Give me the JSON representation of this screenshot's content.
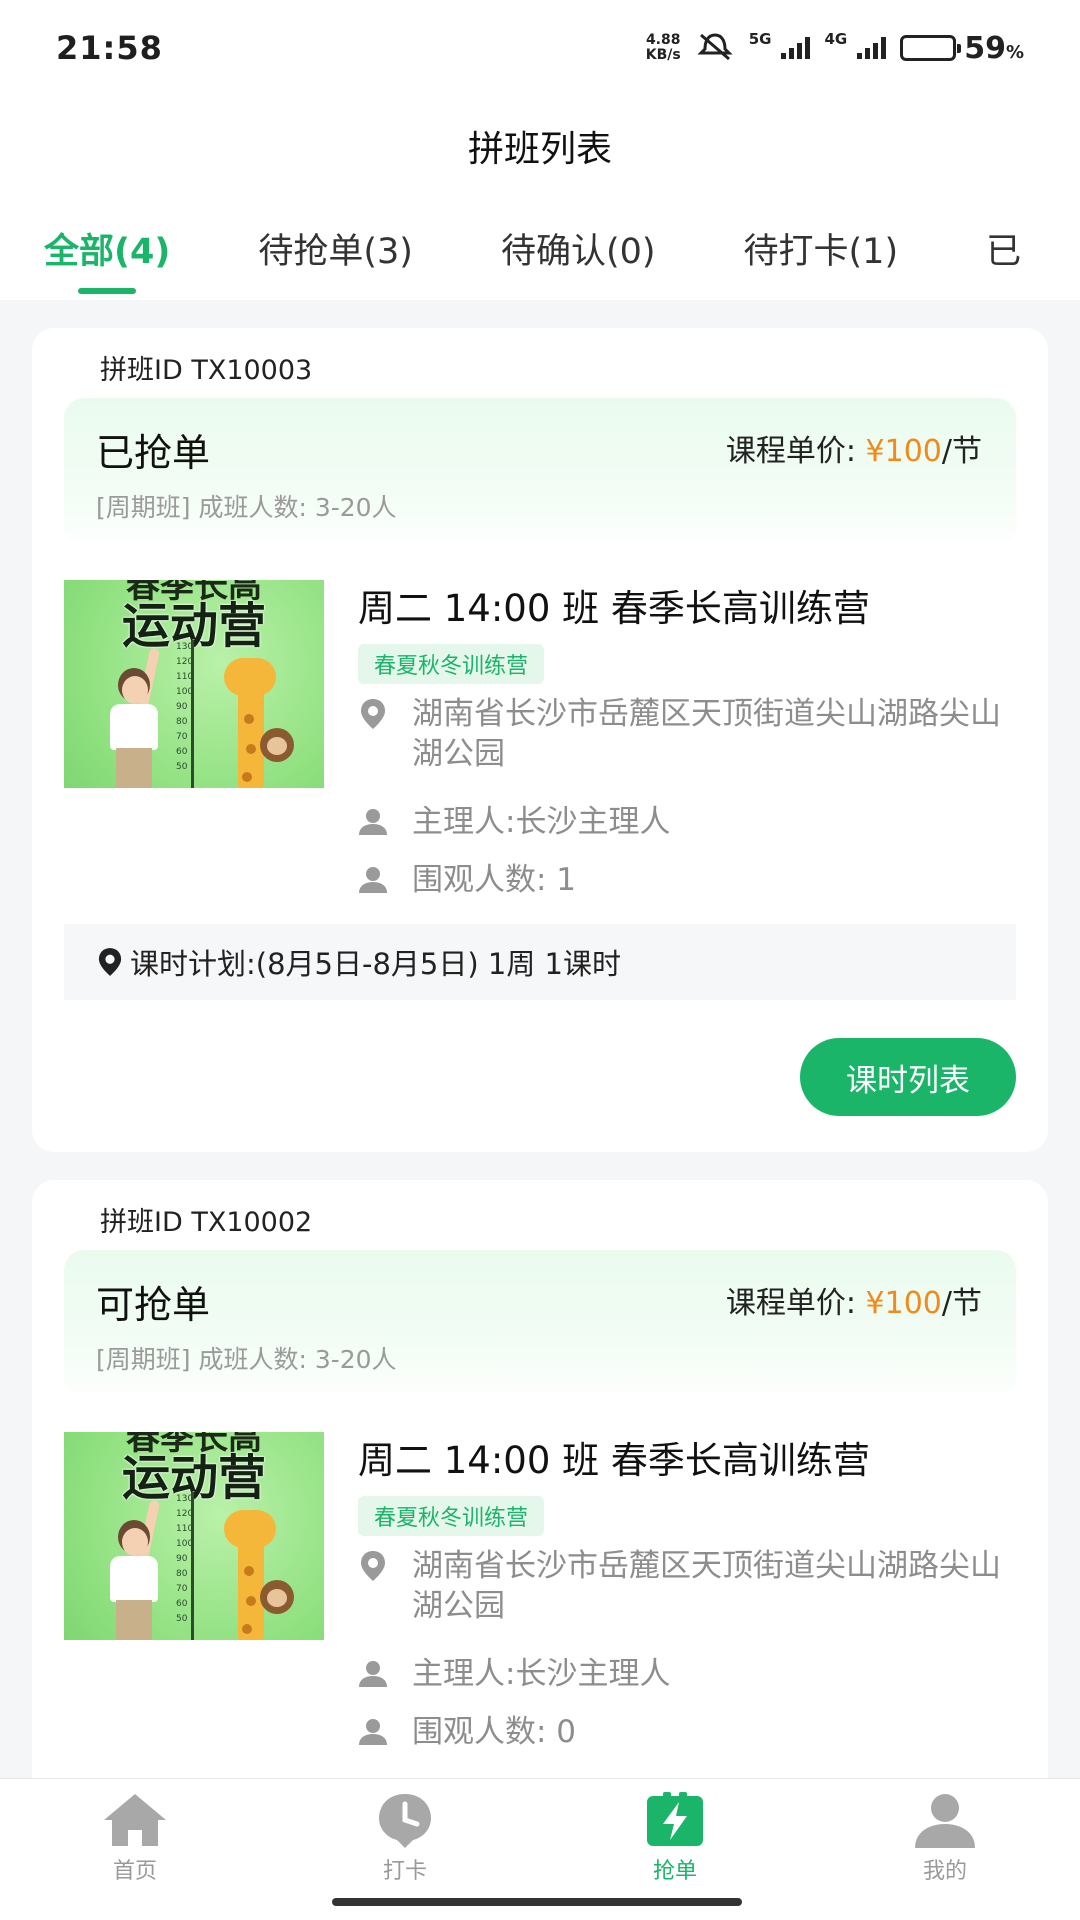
{
  "status_bar": {
    "time": "21:58",
    "net_speed_value": "4.88",
    "net_speed_unit": "KB/s",
    "signal1": "5G",
    "signal2": "4G",
    "battery_percent": "59",
    "battery_unit": "%",
    "battery_level": 0.59
  },
  "title": "拼班列表",
  "tabs": [
    {
      "label": "全部(4)",
      "active": true
    },
    {
      "label": "待抢单(3)",
      "active": false
    },
    {
      "label": "待确认(0)",
      "active": false
    },
    {
      "label": "待打卡(1)",
      "active": false
    },
    {
      "label": "已",
      "active": false
    }
  ],
  "cards": [
    {
      "id_label": "拼班ID TX10003",
      "status": "已抢单",
      "price_label": "课程单价:",
      "price_amount": "¥100",
      "price_unit": "/节",
      "sub_info": "[周期班] 成班人数: 3-20人",
      "thumb_top": "春季长高",
      "thumb_title": "运动营",
      "course_name": "周二 14:00 班 春季长高训练营",
      "tag": "春夏秋冬训练营",
      "address": "湖南省长沙市岳麓区天顶街道尖山湖路尖山湖公园",
      "host": "主理人:长沙主理人",
      "watchers": "围观人数: 1",
      "plan": "课时计划:(8月5日-8月5日) 1周 1课时",
      "button": "课时列表"
    },
    {
      "id_label": "拼班ID TX10002",
      "status": "可抢单",
      "price_label": "课程单价:",
      "price_amount": "¥100",
      "price_unit": "/节",
      "sub_info": "[周期班] 成班人数: 3-20人",
      "thumb_top": "春季长高",
      "thumb_title": "运动营",
      "course_name": "周二 14:00 班 春季长高训练营",
      "tag": "春夏秋冬训练营",
      "address": "湖南省长沙市岳麓区天顶街道尖山湖路尖山湖公园",
      "host": "主理人:长沙主理人",
      "watchers": "围观人数: 0"
    }
  ],
  "ruler_marks": [
    "130",
    "120",
    "110",
    "100",
    "90",
    "80",
    "70",
    "60",
    "50"
  ],
  "bottom_nav": [
    {
      "label": "首页",
      "icon": "home-icon",
      "active": false
    },
    {
      "label": "打卡",
      "icon": "clock-icon",
      "active": false
    },
    {
      "label": "抢单",
      "icon": "lightning-icon",
      "active": true
    },
    {
      "label": "我的",
      "icon": "user-icon",
      "active": false
    }
  ],
  "colors": {
    "accent": "#1bb56a",
    "price": "#f08a1c",
    "muted": "#8d8d8d",
    "background": "#f5f6f7"
  }
}
